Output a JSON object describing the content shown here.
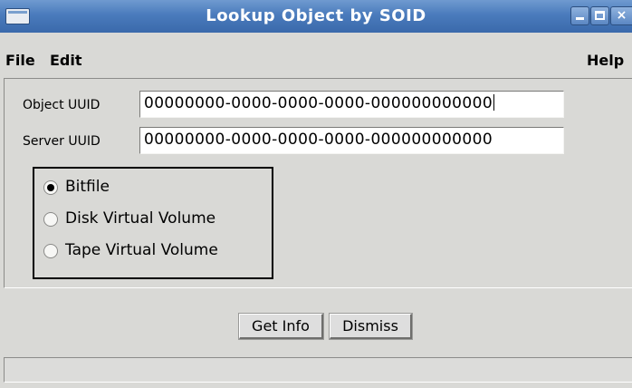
{
  "window": {
    "title": "Lookup Object by SOID",
    "controls": {
      "minimize": "minimize-icon",
      "maximize": "maximize-icon",
      "close": "×"
    }
  },
  "menu": {
    "file": "File",
    "edit": "Edit",
    "help": "Help"
  },
  "form": {
    "object_uuid_label": "Object UUID",
    "object_uuid_value": "00000000-0000-0000-0000-000000000000",
    "server_uuid_label": "Server UUID",
    "server_uuid_value": "00000000-0000-0000-0000-000000000000"
  },
  "object_type": {
    "selected": "Bitfile",
    "options": [
      "Bitfile",
      "Disk Virtual Volume",
      "Tape Virtual Volume"
    ]
  },
  "buttons": {
    "get_info": "Get Info",
    "dismiss": "Dismiss"
  },
  "status": {
    "text": ""
  }
}
